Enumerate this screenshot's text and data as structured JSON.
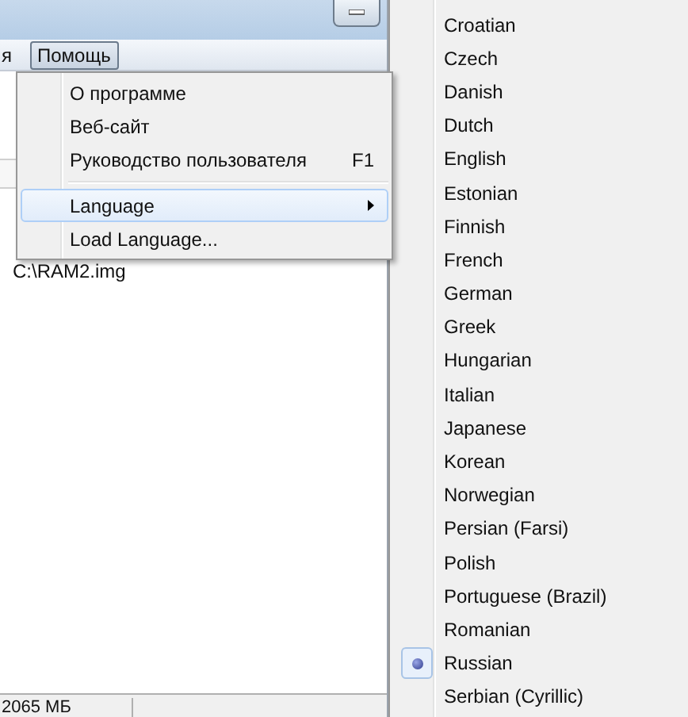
{
  "menu_bar": {
    "items": [
      {
        "label": "я",
        "selected": false
      },
      {
        "label": "Помощь",
        "selected": true
      }
    ]
  },
  "help_menu": {
    "items": [
      {
        "kind": "item",
        "label": "О программе"
      },
      {
        "kind": "item",
        "label": "Веб-сайт"
      },
      {
        "kind": "item",
        "label": "Руководство пользователя",
        "shortcut": "F1"
      },
      {
        "kind": "separator"
      },
      {
        "kind": "submenu",
        "label": "Language",
        "selected": true
      },
      {
        "kind": "item",
        "label": "Load Language..."
      }
    ]
  },
  "file_path": "C:\\RAM2.img",
  "status_bar": {
    "memory": "2065 МБ"
  },
  "language_menu": {
    "items": [
      {
        "label": "Croatian",
        "selected": false
      },
      {
        "label": "Czech",
        "selected": false
      },
      {
        "label": "Danish",
        "selected": false
      },
      {
        "label": "Dutch",
        "selected": false
      },
      {
        "label": "English",
        "selected": false
      },
      {
        "label": "Estonian",
        "selected": false
      },
      {
        "label": "Finnish",
        "selected": false
      },
      {
        "label": "French",
        "selected": false
      },
      {
        "label": "German",
        "selected": false
      },
      {
        "label": "Greek",
        "selected": false
      },
      {
        "label": "Hungarian",
        "selected": false
      },
      {
        "label": "Italian",
        "selected": false
      },
      {
        "label": "Japanese",
        "selected": false
      },
      {
        "label": "Korean",
        "selected": false
      },
      {
        "label": "Norwegian",
        "selected": false
      },
      {
        "label": "Persian (Farsi)",
        "selected": false
      },
      {
        "label": "Polish",
        "selected": false
      },
      {
        "label": "Portuguese (Brazil)",
        "selected": false
      },
      {
        "label": "Romanian",
        "selected": false
      },
      {
        "label": "Russian",
        "selected": true
      },
      {
        "label": "Serbian (Cyrillic)",
        "selected": false
      }
    ]
  }
}
